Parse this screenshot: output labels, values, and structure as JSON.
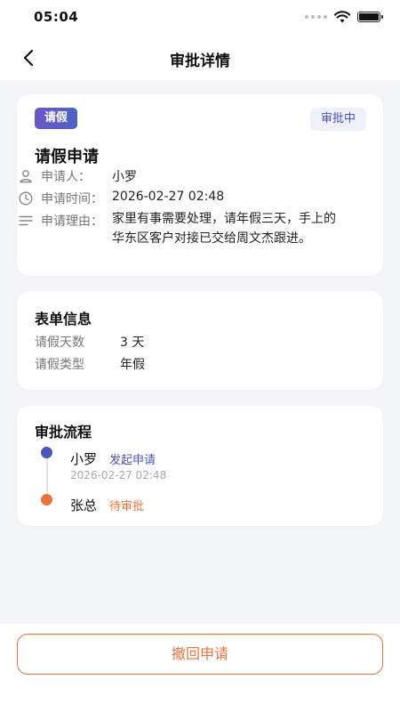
{
  "status_bar": {
    "time": "05:04"
  },
  "nav": {
    "title": "审批详情"
  },
  "summary": {
    "type_tag": "请假",
    "status_tag": "审批中",
    "title": "请假申请",
    "applicant_label": "申请人：",
    "applicant": "小罗",
    "time_label": "申请时间：",
    "time": "2026-02-27 02:48",
    "reason_label": "申请理由：",
    "reason": "家里有事需要处理，请年假三天，手上的华东区客户对接已交给周文杰跟进。"
  },
  "form": {
    "title": "表单信息",
    "rows": [
      {
        "label": "请假天数",
        "value": "3 天"
      },
      {
        "label": "请假类型",
        "value": "年假"
      }
    ]
  },
  "flow": {
    "title": "审批流程",
    "steps": [
      {
        "name": "小罗",
        "action": "发起申请",
        "time": "2026-02-27 02:48",
        "color": "#4b56b8"
      },
      {
        "name": "张总",
        "action": "待审批",
        "time": "",
        "color": "#e8743d"
      }
    ]
  },
  "actions": {
    "withdraw_label": "撤回申请"
  },
  "colors": {
    "primary": "#4b56b8",
    "accent": "#e8743d",
    "background": "#f4f5f9"
  }
}
